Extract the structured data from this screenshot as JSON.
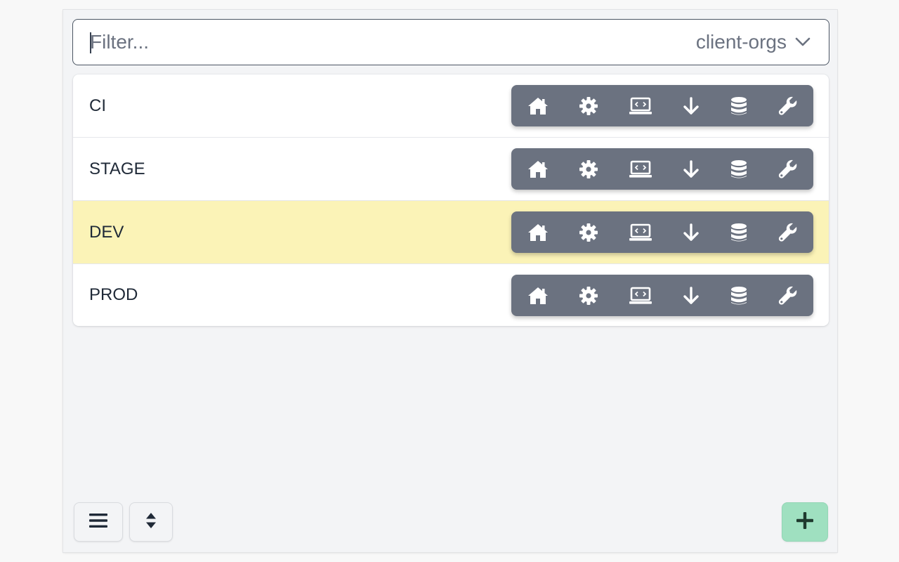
{
  "filter": {
    "placeholder": "Filter...",
    "value": ""
  },
  "org_selector": {
    "selected": "client-orgs",
    "icon": "chevron-down-icon"
  },
  "environments": [
    {
      "label": "CI",
      "highlighted": false
    },
    {
      "label": "STAGE",
      "highlighted": false
    },
    {
      "label": "DEV",
      "highlighted": true
    },
    {
      "label": "PROD",
      "highlighted": false
    }
  ],
  "row_actions": [
    "home-icon",
    "gear-icon",
    "laptop-code-icon",
    "arrow-down-icon",
    "database-icon",
    "wrench-icon"
  ],
  "footer": {
    "menu_icon": "hamburger-menu-icon",
    "sort_icon": "sort-icon",
    "add_icon": "plus-icon"
  },
  "colors": {
    "action_bar": "#6b7280",
    "highlight_row": "#fbf3b7",
    "add_button": "#9fe0c0"
  }
}
